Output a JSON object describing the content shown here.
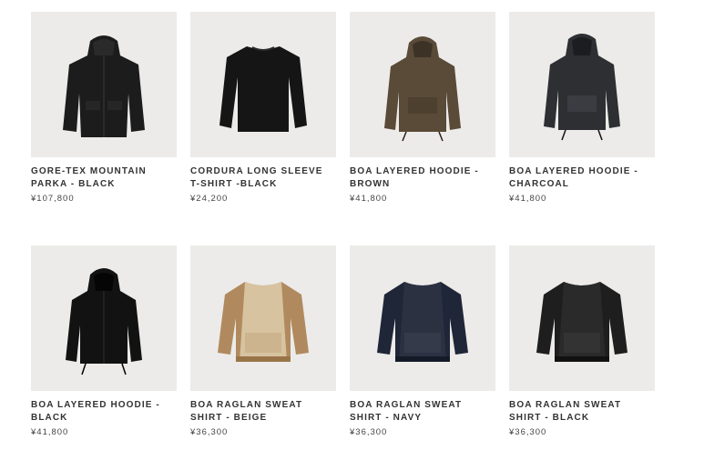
{
  "products": [
    {
      "name": "GORE-TEX MOUNTAIN PARKA - BLACK",
      "price": "¥107,800",
      "image": "black-hooded-parka",
      "color": "#1c1c1c"
    },
    {
      "name": "CORDURA LONG SLEEVE T-SHIRT -BLACK",
      "price": "¥24,200",
      "image": "black-long-sleeve-tshirt",
      "color": "#151515"
    },
    {
      "name": "BOA LAYERED HOODIE - BROWN",
      "price": "¥41,800",
      "image": "brown-anorak-hoodie",
      "color": "#5a4a38"
    },
    {
      "name": "BOA LAYERED HOODIE - CHARCOAL",
      "price": "¥41,800",
      "image": "charcoal-anorak-hoodie",
      "color": "#2d2f33"
    },
    {
      "name": "BOA LAYERED HOODIE - BLACK",
      "price": "¥41,800",
      "image": "black-zip-hoodie",
      "color": "#121212"
    },
    {
      "name": "BOA RAGLAN SWEAT SHIRT - BEIGE",
      "price": "¥36,300",
      "image": "beige-raglan-sweatshirt",
      "color": "#b08a5e"
    },
    {
      "name": "BOA RAGLAN SWEAT SHIRT - NAVY",
      "price": "¥36,300",
      "image": "navy-raglan-sweatshirt",
      "color": "#1f2638"
    },
    {
      "name": "BOA RAGLAN SWEAT SHIRT - BLACK",
      "price": "¥36,300",
      "image": "black-raglan-sweatshirt",
      "color": "#1e1e1e"
    }
  ]
}
